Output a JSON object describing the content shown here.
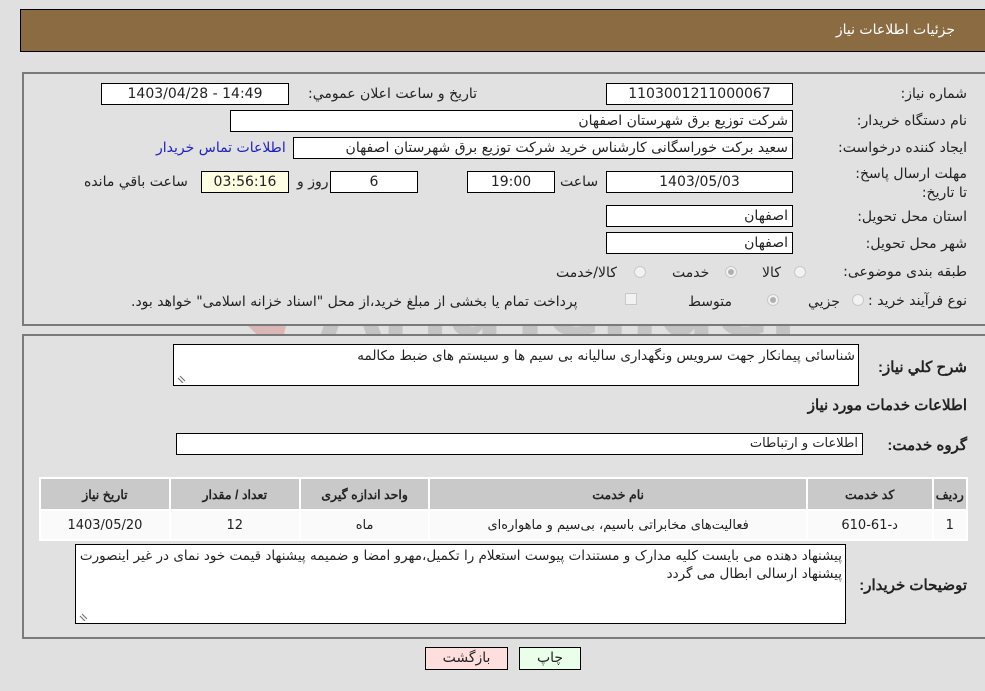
{
  "header": {
    "title": "جزئیات اطلاعات نیاز"
  },
  "form": {
    "need_number_label": "شماره نیاز:",
    "need_number": "1103001211000067",
    "announce_label": "تاریخ و ساعت اعلان عمومي:",
    "announce_value": "1403/04/28 - 14:49",
    "buyer_org_label": "نام دستگاه خریدار:",
    "buyer_org": "شرکت توزیع برق شهرستان اصفهان",
    "creator_label": "ایجاد کننده درخواست:",
    "creator": "سعید برکت خوراسگانی کارشناس خرید شرکت توزیع برق شهرستان اصفهان",
    "contact_link": "اطلاعات تماس خریدار",
    "deadline_label": "مهلت ارسال پاسخ: تا تاریخ:",
    "deadline_date": "1403/05/03",
    "time_label": "ساعت",
    "deadline_time": "19:00",
    "days": "6",
    "days_label": "روز و",
    "remaining": "03:56:16",
    "remaining_label": "ساعت باقي مانده",
    "province_label": "استان محل تحویل:",
    "province": "اصفهان",
    "city_label": "شهر محل تحویل:",
    "city": "اصفهان",
    "category_label": "طبقه بندی موضوعی:",
    "category_options": [
      {
        "label": "کالا",
        "checked": false
      },
      {
        "label": "خدمت",
        "checked": true
      },
      {
        "label": "کالا/خدمت",
        "checked": false
      }
    ],
    "process_label": "نوع فرآیند خرید :",
    "process_options": [
      {
        "label": "جزيي",
        "checked": false
      },
      {
        "label": "متوسط",
        "checked": true
      }
    ],
    "treasury_checkbox_label": "پرداخت تمام یا بخشی از مبلغ خرید،از محل \"اسناد خزانه اسلامی\" خواهد بود.",
    "treasury_checked": false
  },
  "details": {
    "description_label": "شرح کلي نیاز:",
    "description": "شناسائی پیمانکار جهت  سرویس ونگهداری سالیانه بی سیم ها و سیستم های ضبط مکالمه",
    "services_heading": "اطلاعات خدمات مورد نیاز",
    "service_group_label": "گروه خدمت:",
    "service_group": "اطلاعات و ارتباطات",
    "table": {
      "headers": [
        "ردیف",
        "کد خدمت",
        "نام خدمت",
        "واحد اندازه گیری",
        "تعداد / مقدار",
        "تاریخ نیاز"
      ],
      "rows": [
        [
          "1",
          "د-61-610",
          "فعالیت‌های مخابراتی باسیم، بی‌سیم و ماهواره‌ای",
          "ماه",
          "12",
          "1403/05/20"
        ]
      ]
    },
    "buyer_notes_label": "توضیحات خریدار:",
    "buyer_notes": "پیشنهاد دهنده می بایست کلیه مدارک و مستندات پیوست استعلام را تکمیل،مهرو امضا و ضمیمه پیشنهاد قیمت خود نمای در غیر اینصورت پیشنهاد ارسالی ابطال می گردد"
  },
  "buttons": {
    "print": "چاپ",
    "back": "بازگشت"
  },
  "colors": {
    "header": "#8b6c42",
    "print_bg": "#eaffea",
    "back_bg": "#ffdede",
    "remaining_bg": "#fefee2",
    "link": "#2020c0"
  }
}
